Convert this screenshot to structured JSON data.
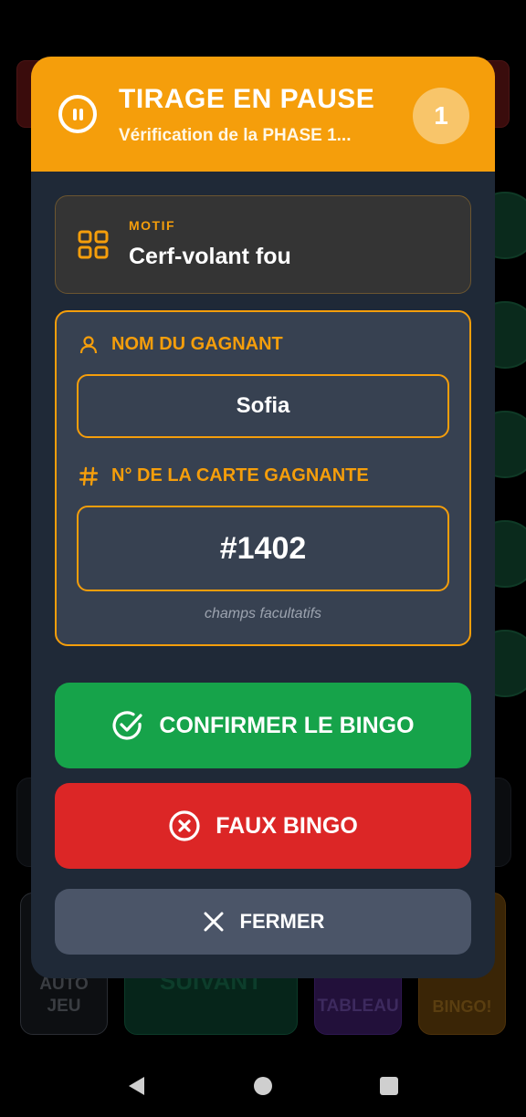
{
  "background": {
    "auto_button": "AUTO JEU",
    "next_button": "SUIVANT",
    "board_button": "TABLEAU",
    "bingo_button": "BINGO!"
  },
  "modal": {
    "title": "TIRAGE EN PAUSE",
    "subtitle": "Vérification de la PHASE 1...",
    "count": "1",
    "motif": {
      "label": "MOTIF",
      "value": "Cerf-volant fou",
      "icon": "grid-icon"
    },
    "winner": {
      "label": "NOM DU GAGNANT",
      "value": "Sofia",
      "icon": "user-icon"
    },
    "card": {
      "label": "N° DE LA CARTE GAGNANTE",
      "value": "#1402",
      "icon": "hash-icon"
    },
    "hint": "champs facultatifs",
    "confirm_label": "CONFIRMER LE BINGO",
    "false_label": "FAUX BINGO",
    "close_label": "FERMER"
  },
  "colors": {
    "accent": "#f59e0b",
    "confirm": "#16a34a",
    "danger": "#dc2626",
    "neutral": "#4b5568",
    "panel": "#1f2937"
  }
}
